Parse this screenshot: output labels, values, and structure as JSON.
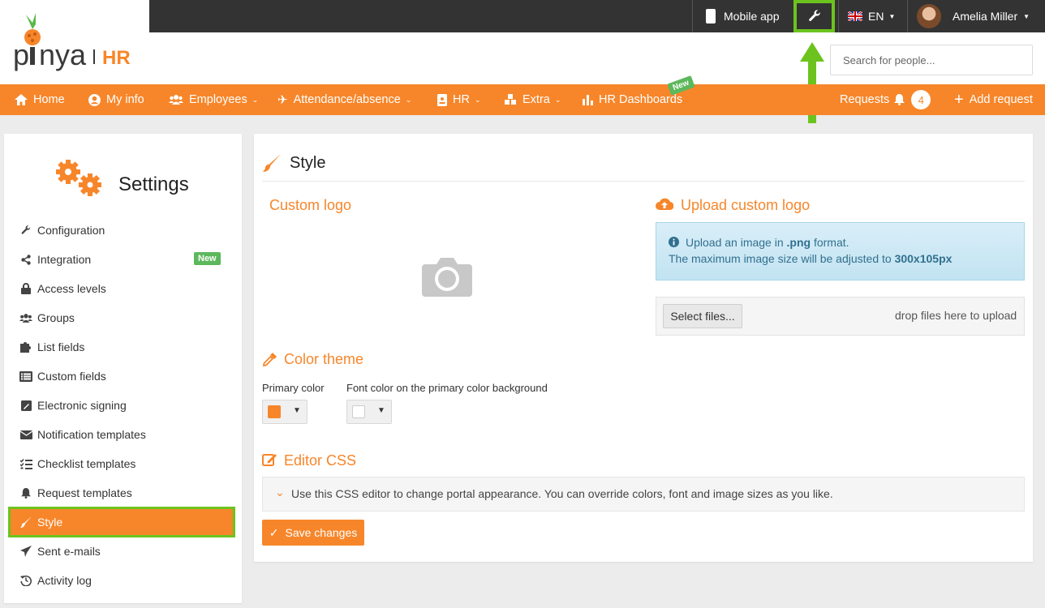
{
  "brand": {
    "name": "pinya",
    "suffix": "HR",
    "accent": "#f7862a",
    "highlight": "#6cc31e"
  },
  "topbar": {
    "mobile_app": "Mobile app",
    "settings_icon": "wrench-icon",
    "language": "EN",
    "user_name": "Amelia Miller"
  },
  "search": {
    "placeholder": "Search for people..."
  },
  "nav": {
    "home": "Home",
    "my_info": "My info",
    "employees": "Employees",
    "attendance": "Attendance/absence",
    "hr": "HR",
    "extra": "Extra",
    "hr_dashboards": "HR Dashboards",
    "new_badge": "New",
    "requests": "Requests",
    "requests_count": "4",
    "add_request": "Add request"
  },
  "sidebar": {
    "title": "Settings",
    "new_badge": "New",
    "items": [
      {
        "label": "Configuration",
        "icon": "wrench-icon"
      },
      {
        "label": "Integration",
        "icon": "share-icon"
      },
      {
        "label": "Access levels",
        "icon": "lock-icon"
      },
      {
        "label": "Groups",
        "icon": "users-icon"
      },
      {
        "label": "List fields",
        "icon": "puzzle-icon"
      },
      {
        "label": "Custom fields",
        "icon": "list-icon"
      },
      {
        "label": "Electronic signing",
        "icon": "sign-icon"
      },
      {
        "label": "Notification templates",
        "icon": "envelope-icon"
      },
      {
        "label": "Checklist templates",
        "icon": "checklist-icon"
      },
      {
        "label": "Request templates",
        "icon": "bell-icon"
      },
      {
        "label": "Style",
        "icon": "brush-icon"
      },
      {
        "label": "Sent e-mails",
        "icon": "send-icon"
      },
      {
        "label": "Activity log",
        "icon": "history-icon"
      }
    ]
  },
  "main": {
    "title": "Style",
    "custom_logo": "Custom logo",
    "upload_custom_logo": "Upload custom logo",
    "info_line1_pre": "Upload an image in ",
    "info_line1_bold": ".png",
    "info_line1_post": " format.",
    "info_line2_pre": "The maximum image size will be adjusted to ",
    "info_line2_bold": "300x105px",
    "select_files": "Select files...",
    "drop_files": "drop files here to upload",
    "color_theme": "Color theme",
    "primary_color_label": "Primary color",
    "primary_color_value": "#f7862a",
    "font_color_label": "Font color on the primary color background",
    "font_color_value": "#ffffff",
    "editor_css": "Editor CSS",
    "editor_css_hint": "Use this CSS editor to change portal appearance. You can override colors, font and image sizes as you like.",
    "save_changes": "Save changes"
  }
}
